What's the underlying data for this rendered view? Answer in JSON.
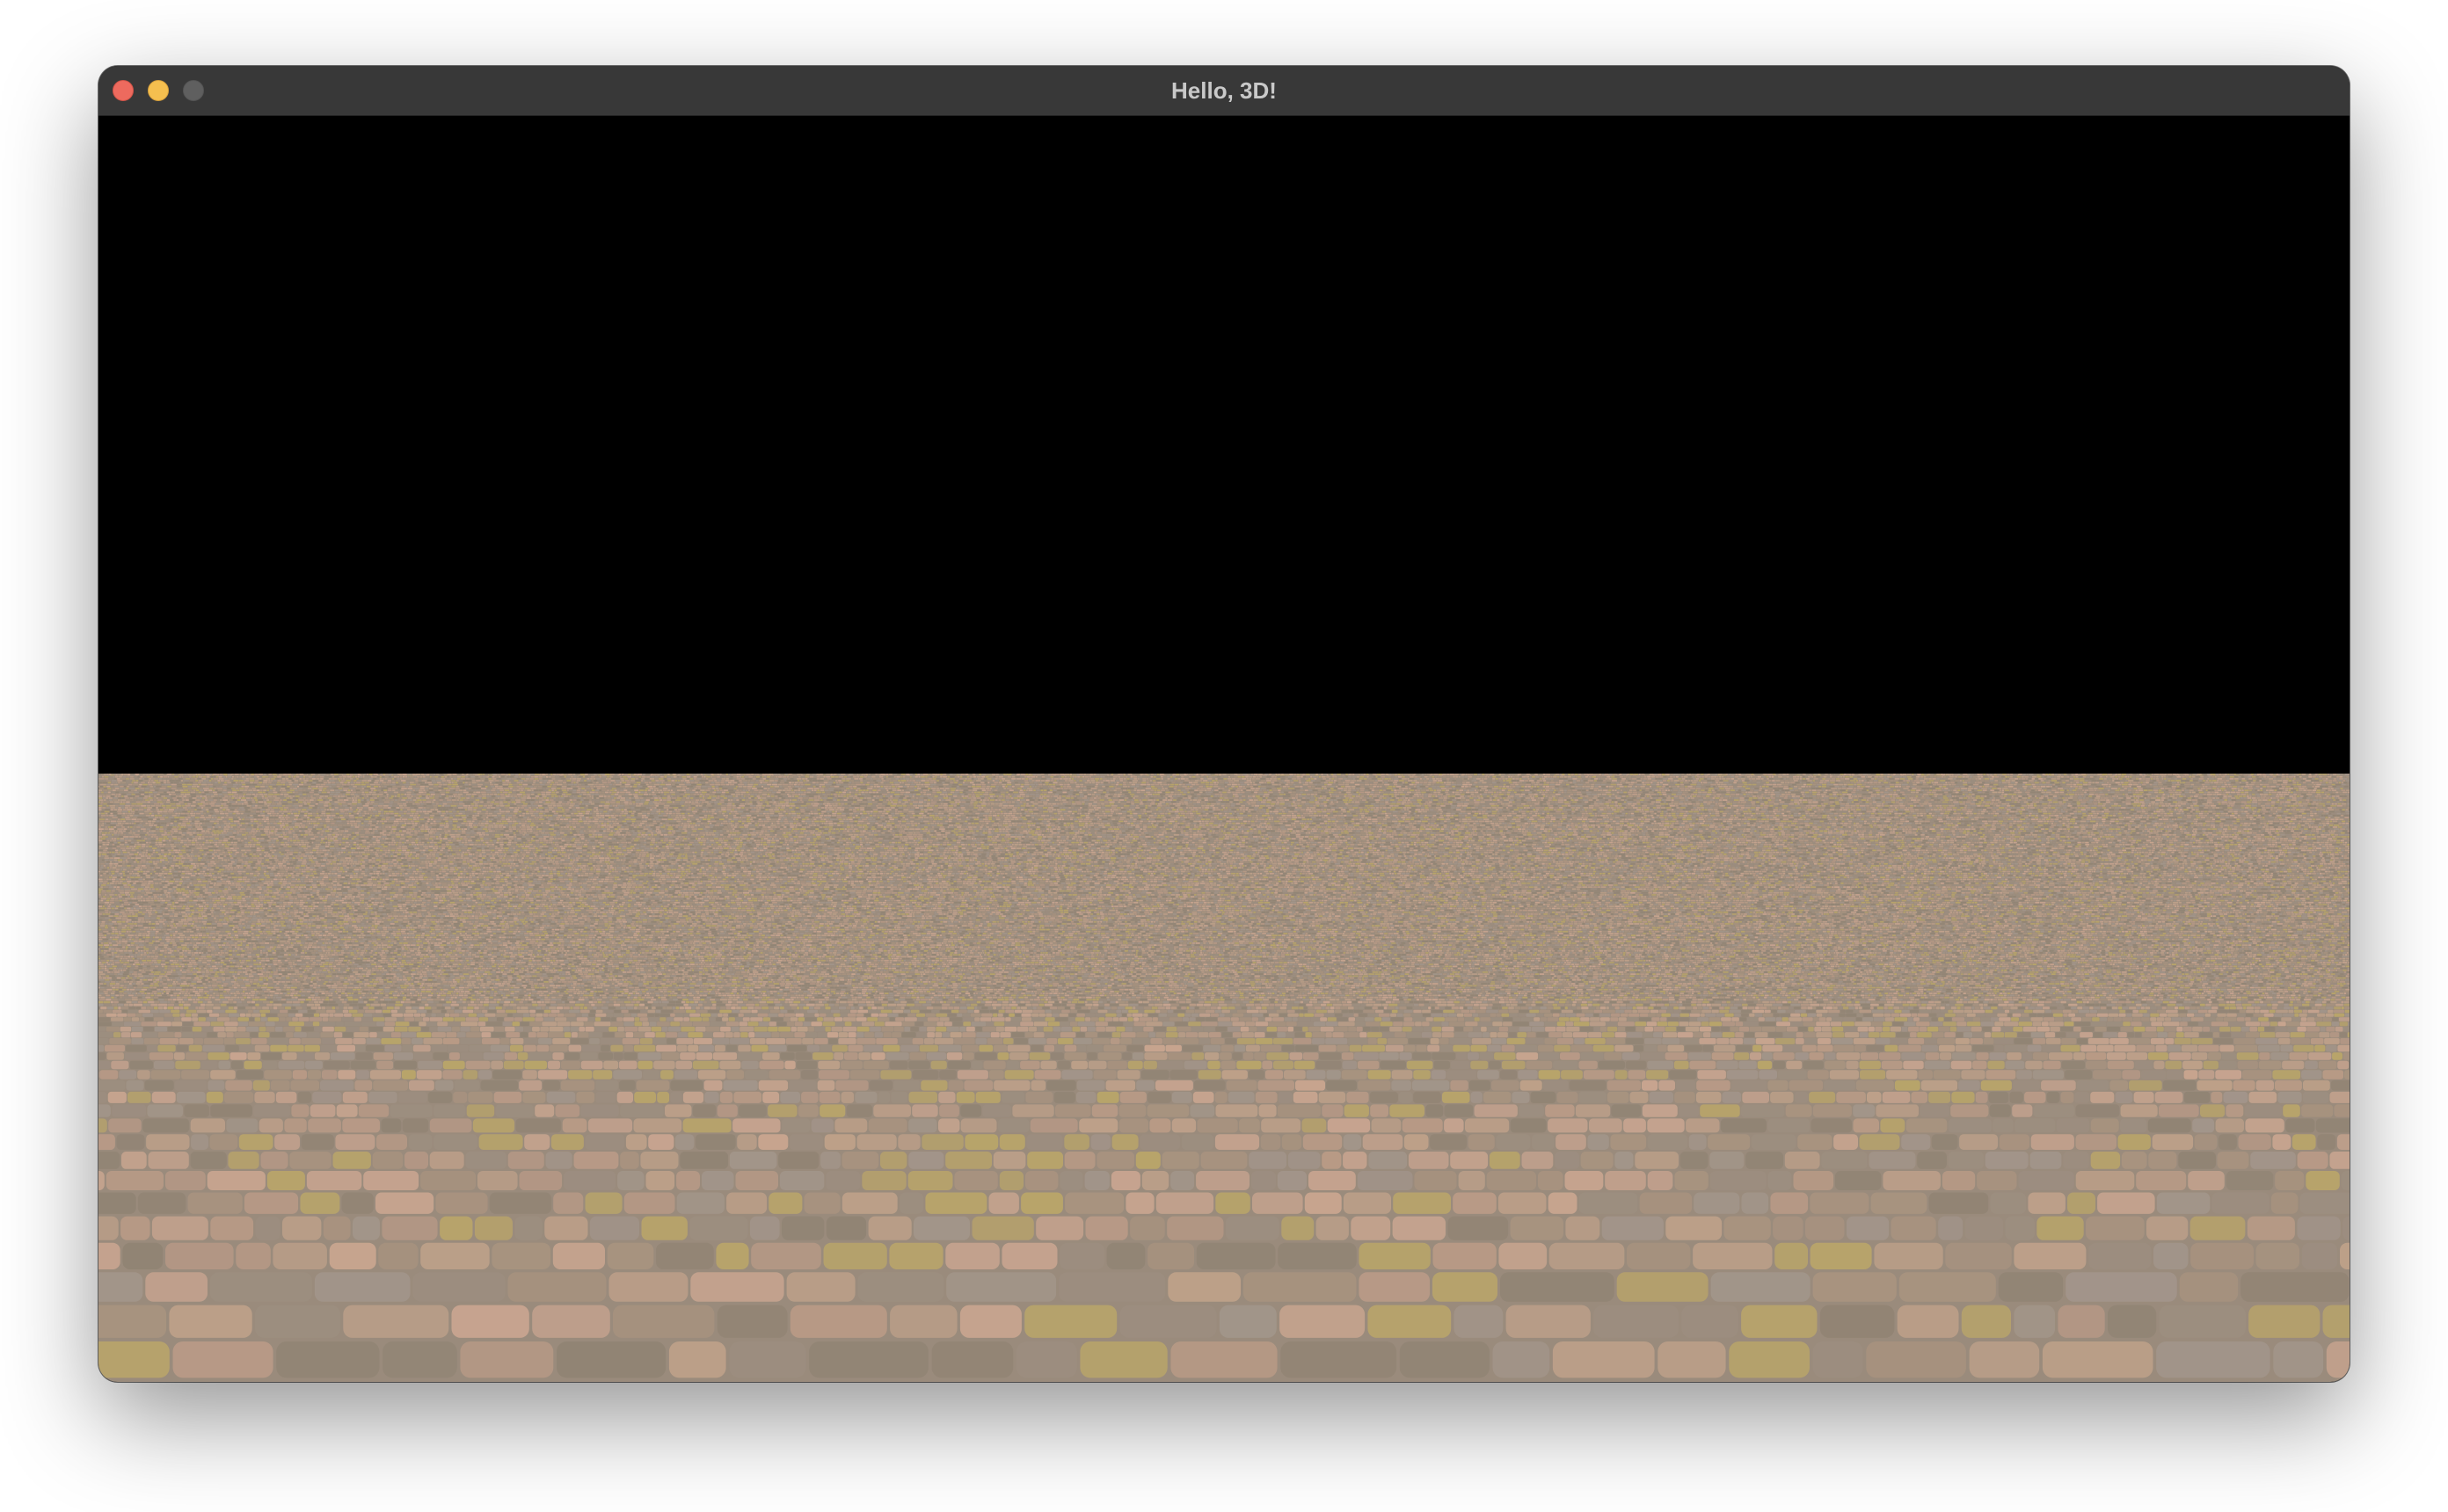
{
  "window": {
    "title": "Hello, 3D!"
  },
  "titlebar": {
    "buttons": [
      {
        "name": "close",
        "color": "#ed6a5e"
      },
      {
        "name": "minimize",
        "color": "#f5bf4f"
      },
      {
        "name": "zoom",
        "color": "#5f5f5f"
      }
    ]
  },
  "scene": {
    "sky_color": "#000000",
    "floor_texture": "cobblestone",
    "floor_palette": [
      "#a8937f",
      "#b89a86",
      "#9c8e80",
      "#bda089",
      "#a2958a",
      "#c7a48f",
      "#918474",
      "#b8a46a"
    ]
  }
}
